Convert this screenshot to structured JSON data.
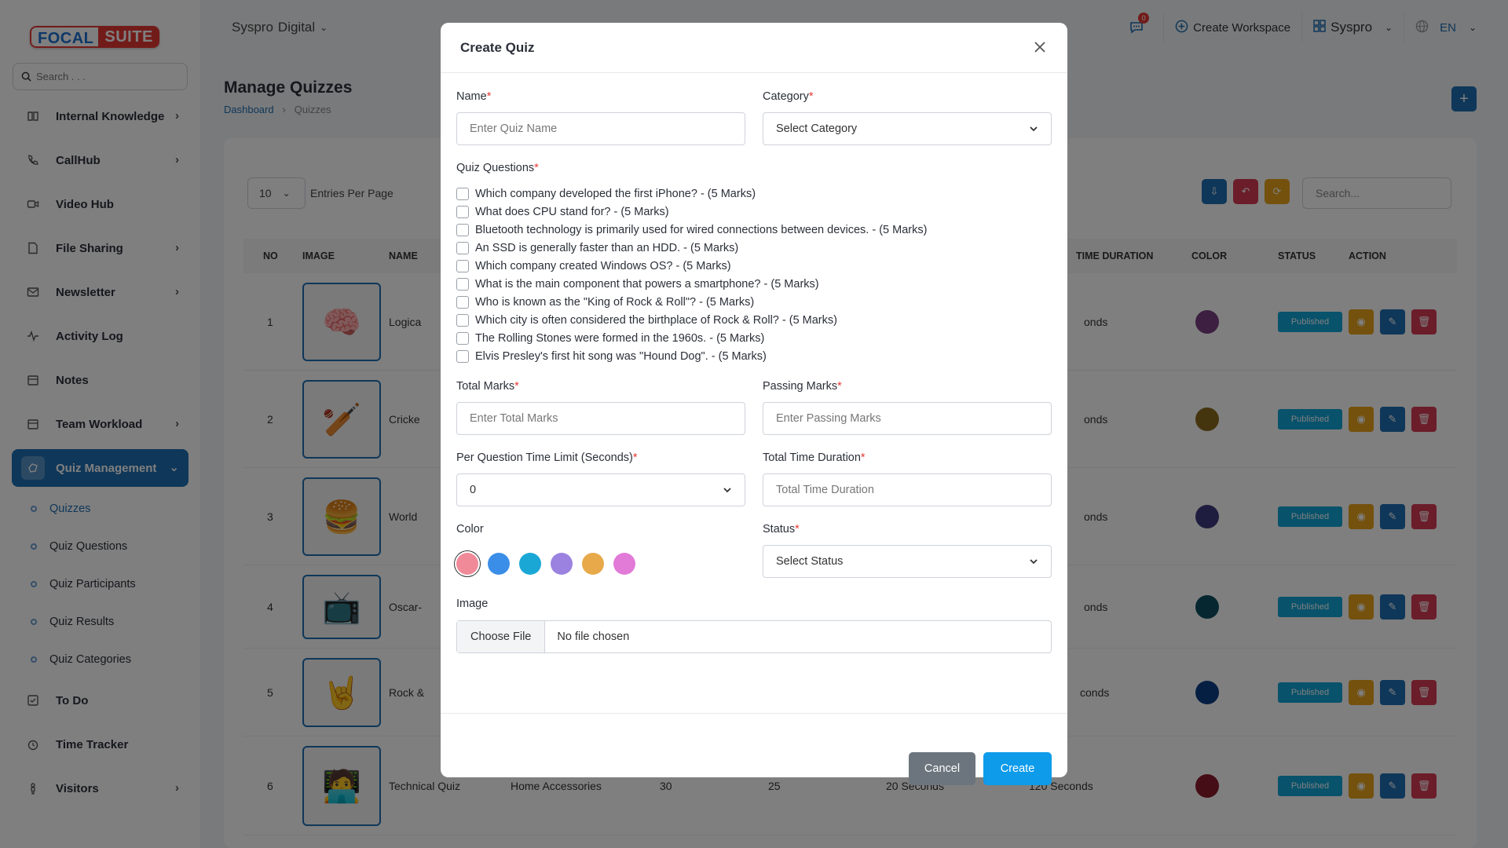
{
  "app": {
    "logo_left": "FOCAL",
    "logo_right": "SUITE",
    "search_placeholder": "Search . . ."
  },
  "sidebar": {
    "items": [
      {
        "label": "Internal Knowledge",
        "icon": "book-icon",
        "chevron": true
      },
      {
        "label": "CallHub",
        "icon": "phone-icon",
        "chevron": true
      },
      {
        "label": "Video Hub",
        "icon": "video-icon",
        "chevron": false
      },
      {
        "label": "File Sharing",
        "icon": "file-icon",
        "chevron": true
      },
      {
        "label": "Newsletter",
        "icon": "mail-icon",
        "chevron": true
      },
      {
        "label": "Activity Log",
        "icon": "activity-icon",
        "chevron": false
      },
      {
        "label": "Notes",
        "icon": "calendar-icon",
        "chevron": false
      },
      {
        "label": "Team Workload",
        "icon": "calendar-icon",
        "chevron": true
      }
    ],
    "active": {
      "label": "Quiz Management",
      "icon": "quiz-icon"
    },
    "sub_items": [
      "Quizzes",
      "Quiz Questions",
      "Quiz Participants",
      "Quiz Results",
      "Quiz Categories"
    ],
    "items_after": [
      {
        "label": "To Do",
        "icon": "checkbox-icon",
        "chevron": false
      },
      {
        "label": "Time Tracker",
        "icon": "clock-icon",
        "chevron": false
      },
      {
        "label": "Visitors",
        "icon": "person-icon",
        "chevron": true
      }
    ]
  },
  "topbar": {
    "workspace_a": "Syspro",
    "workspace_b": "Digital",
    "notif_count": "0",
    "create_workspace": "Create Workspace",
    "org": "Syspro",
    "lang": "EN"
  },
  "page": {
    "title": "Manage Quizzes",
    "crumb_home": "Dashboard",
    "crumb_current": "Quizzes",
    "entries_value": "10",
    "entries_label": "Entries Per Page",
    "search_placeholder": "Search..."
  },
  "table": {
    "headers": {
      "no": "NO",
      "image": "IMAGE",
      "name": "NAME",
      "time": "TIME DURATION",
      "color": "COLOR",
      "status": "STATUS",
      "action": "ACTION"
    },
    "rows": [
      {
        "no": "1",
        "name": "Logica",
        "time": "onds",
        "color": "#7b3f83",
        "status": "Published",
        "emoji": "🧠"
      },
      {
        "no": "2",
        "name": "Cricke",
        "time": "onds",
        "color": "#8b6a1f",
        "status": "Published",
        "emoji": "🏏"
      },
      {
        "no": "3",
        "name": "World",
        "time": "onds",
        "color": "#3f3a7e",
        "status": "Published",
        "emoji": "🍔"
      },
      {
        "no": "4",
        "name": "Oscar-",
        "time": "onds",
        "color": "#0d4f5f",
        "status": "Published",
        "emoji": "📺"
      },
      {
        "no": "5",
        "name": "Rock &",
        "time": "conds",
        "color": "#0b3e86",
        "status": "Published",
        "emoji": "🤘"
      },
      {
        "no": "6",
        "name": "Technical Quiz",
        "category": "Home Accessories",
        "total": "30",
        "passing": "25",
        "per_q": "20 Seconds",
        "time": "120 Seconds",
        "color": "#8b1a2c",
        "status": "Published",
        "emoji": "🧑‍💻"
      }
    ]
  },
  "modal": {
    "title": "Create Quiz",
    "name_label": "Name",
    "name_placeholder": "Enter Quiz Name",
    "category_label": "Category",
    "category_value": "Select Category",
    "questions_label": "Quiz Questions",
    "questions": [
      "Which company developed the first iPhone? - (5 Marks)",
      "What does CPU stand for? - (5 Marks)",
      "Bluetooth technology is primarily used for wired connections between devices. - (5 Marks)",
      "An SSD is generally faster than an HDD. - (5 Marks)",
      "Which company created Windows OS? - (5 Marks)",
      "What is the main component that powers a smartphone? - (5 Marks)",
      "Who is known as the \"King of Rock & Roll\"? - (5 Marks)",
      "Which city is often considered the birthplace of Rock & Roll? - (5 Marks)",
      "The Rolling Stones were formed in the 1960s. - (5 Marks)",
      "Elvis Presley's first hit song was \"Hound Dog\". - (5 Marks)"
    ],
    "total_marks_label": "Total Marks",
    "total_marks_placeholder": "Enter Total Marks",
    "passing_marks_label": "Passing Marks",
    "passing_marks_placeholder": "Enter Passing Marks",
    "per_q_label": "Per Question Time Limit (Seconds)",
    "per_q_value": "0",
    "total_time_label": "Total Time Duration",
    "total_time_placeholder": "Total Time Duration",
    "color_label": "Color",
    "colors": [
      "#f08a99",
      "#3b8ee8",
      "#1aa7d6",
      "#9b82e0",
      "#e8a94a",
      "#e27ad8"
    ],
    "status_label": "Status",
    "status_value": "Select Status",
    "image_label": "Image",
    "file_button": "Choose File",
    "file_text": "No file chosen",
    "cancel": "Cancel",
    "create": "Create"
  }
}
